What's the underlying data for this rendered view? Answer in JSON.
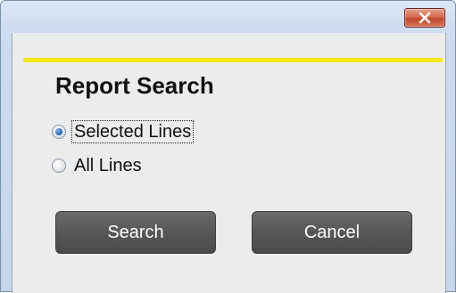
{
  "dialog": {
    "close_icon": "close-x-icon",
    "heading": "Report Search",
    "accent_color": "#f7ea1a",
    "options": [
      {
        "label": "Selected Lines",
        "checked": true
      },
      {
        "label": "All Lines",
        "checked": false
      }
    ],
    "buttons": {
      "search_label": "Search",
      "cancel_label": "Cancel"
    }
  }
}
